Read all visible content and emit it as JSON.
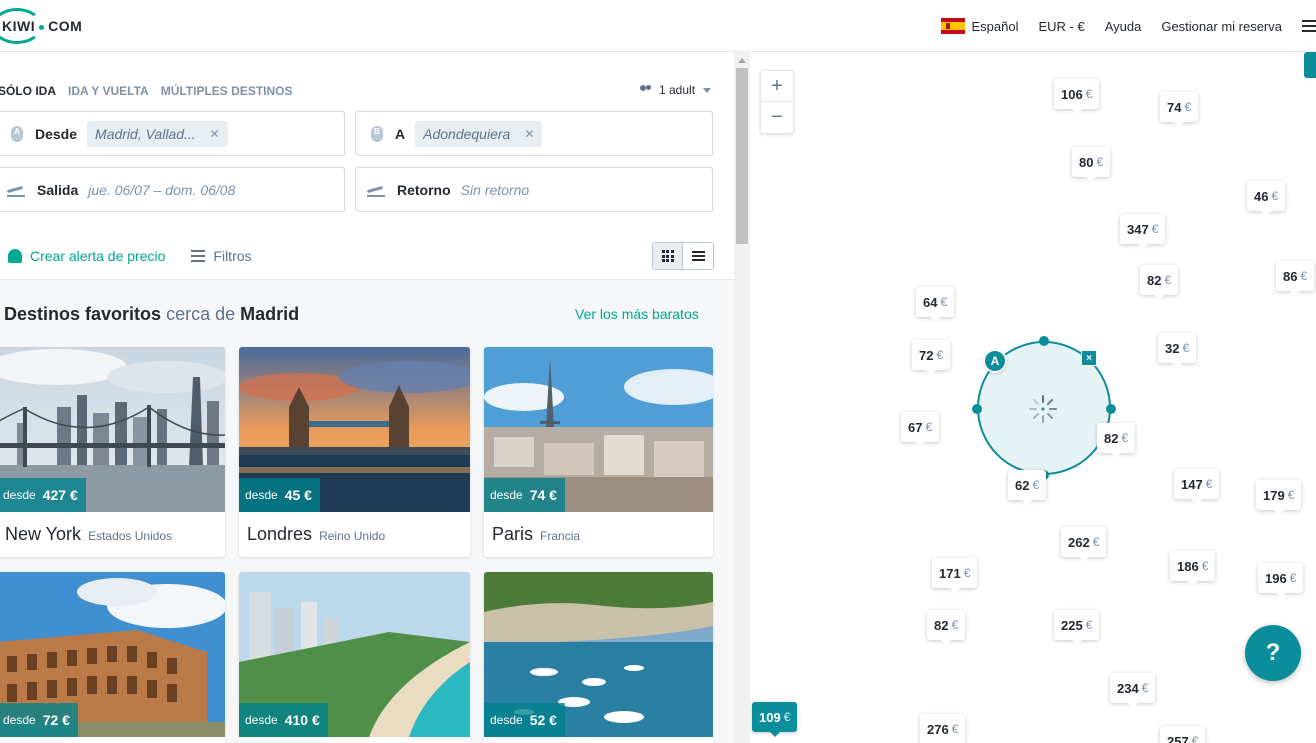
{
  "header": {
    "logo_text_left": "KIWI",
    "logo_text_right": "COM",
    "language": "Español",
    "currency": "EUR - €",
    "help": "Ayuda",
    "manage_booking": "Gestionar mi reserva"
  },
  "search": {
    "tabs": [
      {
        "label": "SÓLO IDA",
        "active": true
      },
      {
        "label": "IDA Y VUELTA",
        "active": false
      },
      {
        "label": "MÚLTIPLES DESTINOS",
        "active": false
      }
    ],
    "passengers": "1 adult",
    "from_label": "Desde",
    "from_marker": "A",
    "from_value": "Madrid, Vallad...",
    "to_label": "A",
    "to_marker": "B",
    "to_value": "Adondequiera",
    "departure_label": "Salida",
    "departure_value": "jue. 06/07 – dom. 06/08",
    "return_label": "Retorno",
    "return_value": "Sin retorno",
    "price_alert": "Crear alerta de precio",
    "filters": "Filtros"
  },
  "favorites": {
    "title_bold": "Destinos favoritos",
    "title_light": "cerca de",
    "title_city": "Madrid",
    "cheapest_link": "Ver los más baratos",
    "price_prefix": "desde",
    "cards": [
      {
        "city": "New York",
        "country": "Estados Unidos",
        "price": "427 €"
      },
      {
        "city": "Londres",
        "country": "Reino Unido",
        "price": "45 €"
      },
      {
        "city": "Paris",
        "country": "Francia",
        "price": "74 €"
      },
      {
        "city": "",
        "country": "",
        "price": "72 €"
      },
      {
        "city": "",
        "country": "",
        "price": "410 €"
      },
      {
        "city": "",
        "country": "",
        "price": "52 €"
      }
    ]
  },
  "map": {
    "zoom_in": "+",
    "zoom_out": "−",
    "origin_marker": "A",
    "close_marker": "×",
    "currency_symbol": "€",
    "help_button": "?",
    "prices": [
      "106",
      "74",
      "80",
      "46",
      "347",
      "82",
      "86",
      "64",
      "72",
      "32",
      "67",
      "82",
      "62",
      "147",
      "179",
      "262",
      "171",
      "186",
      "196",
      "82",
      "225",
      "234",
      "109",
      "276",
      "257"
    ]
  },
  "colors": {
    "accent": "#00a991",
    "map_teal": "#0c8d9b",
    "text": "#252a31",
    "muted": "#7f91a8"
  }
}
